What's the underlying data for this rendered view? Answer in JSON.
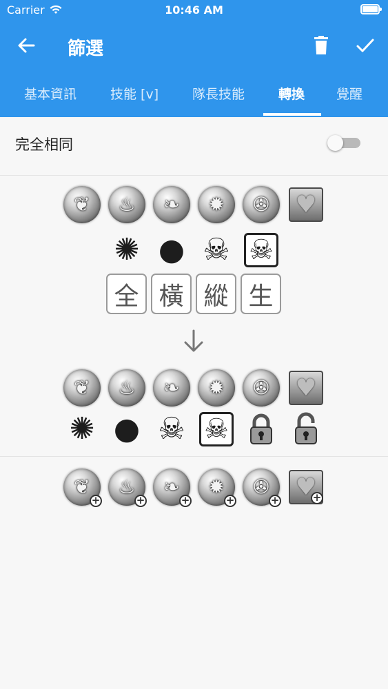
{
  "status_bar": {
    "carrier": "Carrier",
    "time": "10:46 AM"
  },
  "toolbar": {
    "title": "篩選",
    "back_icon": "arrow-left-icon",
    "delete_icon": "trash-icon",
    "confirm_icon": "check-icon"
  },
  "tabs": [
    {
      "label": "基本資訊",
      "active": false
    },
    {
      "label": "技能 [v]",
      "active": false
    },
    {
      "label": "隊長技能",
      "active": false
    },
    {
      "label": "轉換",
      "active": true
    },
    {
      "label": "覺醒",
      "active": false
    }
  ],
  "filter": {
    "exact_match_label": "完全相同",
    "exact_match_on": false
  },
  "source_orbs": [
    "water-orb-icon",
    "fire-orb-icon",
    "wood-orb-icon",
    "light-orb-icon",
    "dark-orb-icon",
    "heart-orb-icon"
  ],
  "source_hazards": [
    "jammer-orb-icon",
    "bomb-orb-icon",
    "poison-orb-icon",
    "mortal-poison-orb-icon"
  ],
  "modes": [
    "全",
    "橫",
    "縱",
    "生"
  ],
  "target_orbs": [
    "water-orb-icon",
    "fire-orb-icon",
    "wood-orb-icon",
    "light-orb-icon",
    "dark-orb-icon",
    "heart-orb-icon"
  ],
  "target_extras": [
    "jammer-orb-icon",
    "bomb-orb-icon",
    "poison-orb-icon",
    "mortal-poison-orb-icon",
    "lock-icon",
    "unlock-icon"
  ],
  "enhanced_orbs": [
    "water-orb-plus-icon",
    "fire-orb-plus-icon",
    "wood-orb-plus-icon",
    "light-orb-plus-icon",
    "dark-orb-plus-icon",
    "heart-orb-plus-icon"
  ]
}
